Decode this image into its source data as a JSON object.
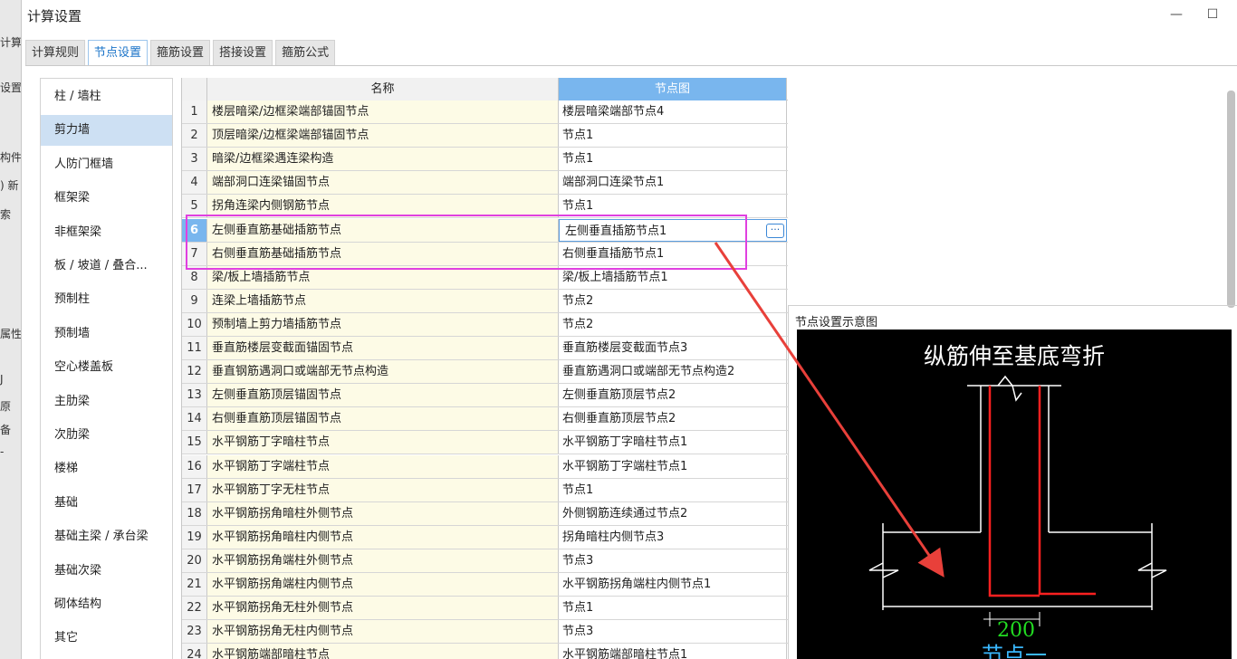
{
  "background_window": {
    "fragments": [
      "计算",
      "设置",
      "构件",
      ") 新",
      "索",
      "属性",
      "J",
      "原",
      "备",
      "-"
    ]
  },
  "window": {
    "title": "计算设置",
    "minimize_glyph": "—",
    "maximize_glyph": "☐"
  },
  "tabs": [
    {
      "label": "计算规则",
      "active": false
    },
    {
      "label": "节点设置",
      "active": true
    },
    {
      "label": "箍筋设置",
      "active": false
    },
    {
      "label": "搭接设置",
      "active": false
    },
    {
      "label": "箍筋公式",
      "active": false
    }
  ],
  "leftnav": {
    "items": [
      {
        "label": "柱 / 墙柱"
      },
      {
        "label": "剪力墙",
        "active": true
      },
      {
        "label": "人防门框墙"
      },
      {
        "label": "框架梁"
      },
      {
        "label": "非框架梁"
      },
      {
        "label": "板 / 坡道 / 叠合..."
      },
      {
        "label": "预制柱"
      },
      {
        "label": "预制墙"
      },
      {
        "label": "空心楼盖板"
      },
      {
        "label": "主肋梁"
      },
      {
        "label": "次肋梁"
      },
      {
        "label": "楼梯"
      },
      {
        "label": "基础"
      },
      {
        "label": "基础主梁 / 承台梁"
      },
      {
        "label": "基础次梁"
      },
      {
        "label": "砌体结构"
      },
      {
        "label": "其它"
      }
    ]
  },
  "grid": {
    "headers": {
      "name": "名称",
      "node": "节点图"
    },
    "selected_row": 6,
    "rows": [
      {
        "num": "1",
        "name": "楼层暗梁/边框梁端部锚固节点",
        "node": "楼层暗梁端部节点4"
      },
      {
        "num": "2",
        "name": "顶层暗梁/边框梁端部锚固节点",
        "node": "节点1"
      },
      {
        "num": "3",
        "name": "暗梁/边框梁遇连梁构造",
        "node": "节点1"
      },
      {
        "num": "4",
        "name": "端部洞口连梁锚固节点",
        "node": "端部洞口连梁节点1"
      },
      {
        "num": "5",
        "name": "拐角连梁内侧钢筋节点",
        "node": "节点1"
      },
      {
        "num": "6",
        "name": "左侧垂直筋基础插筋节点",
        "node": "左侧垂直插筋节点1"
      },
      {
        "num": "7",
        "name": "右侧垂直筋基础插筋节点",
        "node": "右侧垂直插筋节点1"
      },
      {
        "num": "8",
        "name": "梁/板上墙插筋节点",
        "node": "梁/板上墙插筋节点1"
      },
      {
        "num": "9",
        "name": "连梁上墙插筋节点",
        "node": "节点2"
      },
      {
        "num": "10",
        "name": "预制墙上剪力墙插筋节点",
        "node": "节点2"
      },
      {
        "num": "11",
        "name": "垂直筋楼层变截面锚固节点",
        "node": "垂直筋楼层变截面节点3"
      },
      {
        "num": "12",
        "name": "垂直钢筋遇洞口或端部无节点构造",
        "node": "垂直筋遇洞口或端部无节点构造2"
      },
      {
        "num": "13",
        "name": "左侧垂直筋顶层锚固节点",
        "node": "左侧垂直筋顶层节点2"
      },
      {
        "num": "14",
        "name": "右侧垂直筋顶层锚固节点",
        "node": "右侧垂直筋顶层节点2"
      },
      {
        "num": "15",
        "name": "水平钢筋丁字暗柱节点",
        "node": "水平钢筋丁字暗柱节点1"
      },
      {
        "num": "16",
        "name": "水平钢筋丁字端柱节点",
        "node": "水平钢筋丁字端柱节点1"
      },
      {
        "num": "17",
        "name": "水平钢筋丁字无柱节点",
        "node": "节点1"
      },
      {
        "num": "18",
        "name": "水平钢筋拐角暗柱外侧节点",
        "node": "外侧钢筋连续通过节点2"
      },
      {
        "num": "19",
        "name": "水平钢筋拐角暗柱内侧节点",
        "node": "拐角暗柱内侧节点3"
      },
      {
        "num": "20",
        "name": "水平钢筋拐角端柱外侧节点",
        "node": "节点3"
      },
      {
        "num": "21",
        "name": "水平钢筋拐角端柱内侧节点",
        "node": "水平钢筋拐角端柱内侧节点1"
      },
      {
        "num": "22",
        "name": "水平钢筋拐角无柱外侧节点",
        "node": "节点1"
      },
      {
        "num": "23",
        "name": "水平钢筋拐角无柱内侧节点",
        "node": "节点3"
      },
      {
        "num": "24",
        "name": "水平钢筋端部暗柱节点",
        "node": "水平钢筋端部暗柱节点1"
      }
    ],
    "edit_button_glyph": "···"
  },
  "preview": {
    "label": "节点设置示意图",
    "diagram_title": "纵筋伸至基底弯折",
    "dimension": "200",
    "caption": "节点一"
  },
  "colors": {
    "accent": "#79b6ee",
    "highlight_box": "#e040e0",
    "annotation_arrow": "#e8403a",
    "rebar": "#ff2020",
    "dimension_text": "#22dd22",
    "caption_text": "#3ab8ff"
  }
}
